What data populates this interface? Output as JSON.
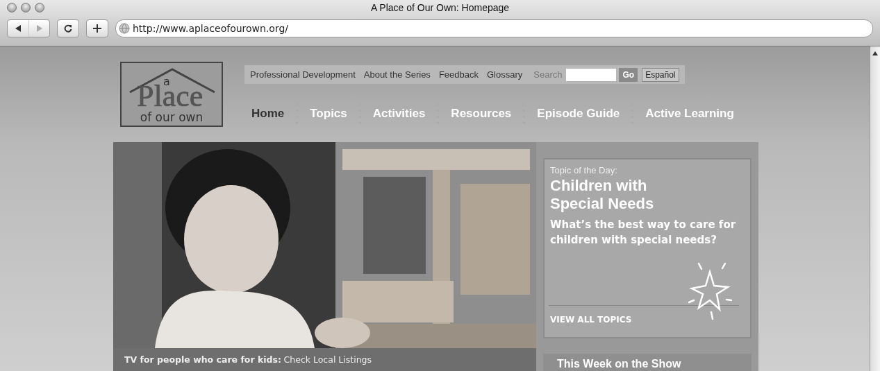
{
  "window": {
    "title": "A Place of Our Own: Homepage"
  },
  "toolbar": {
    "url": "http://www.aplaceofourown.org/"
  },
  "site": {
    "logo": {
      "small": "a",
      "large": "Place",
      "bottom": "of our own"
    },
    "utility_links": [
      "Professional Development",
      "About the Series",
      "Feedback",
      "Glossary"
    ],
    "search": {
      "label": "Search",
      "button": "Go"
    },
    "language_button": "Español",
    "nav": [
      {
        "label": "Home",
        "selected": true
      },
      {
        "label": "Topics",
        "selected": false
      },
      {
        "label": "Activities",
        "selected": false
      },
      {
        "label": "Resources",
        "selected": false
      },
      {
        "label": "Episode Guide",
        "selected": false
      },
      {
        "label": "Active Learning",
        "selected": false
      }
    ],
    "hero": {
      "kind": "picture",
      "caption_label": "TV for people who care for kids:",
      "caption_link": "Check Local Listings"
    },
    "topic": {
      "kicker": "Topic of the Day:",
      "title": "Children with Special Needs",
      "question": "What’s the best way to care for children with special needs?",
      "link": "VIEW ALL TOPICS"
    },
    "this_week": {
      "title": "This Week on the Show"
    }
  }
}
